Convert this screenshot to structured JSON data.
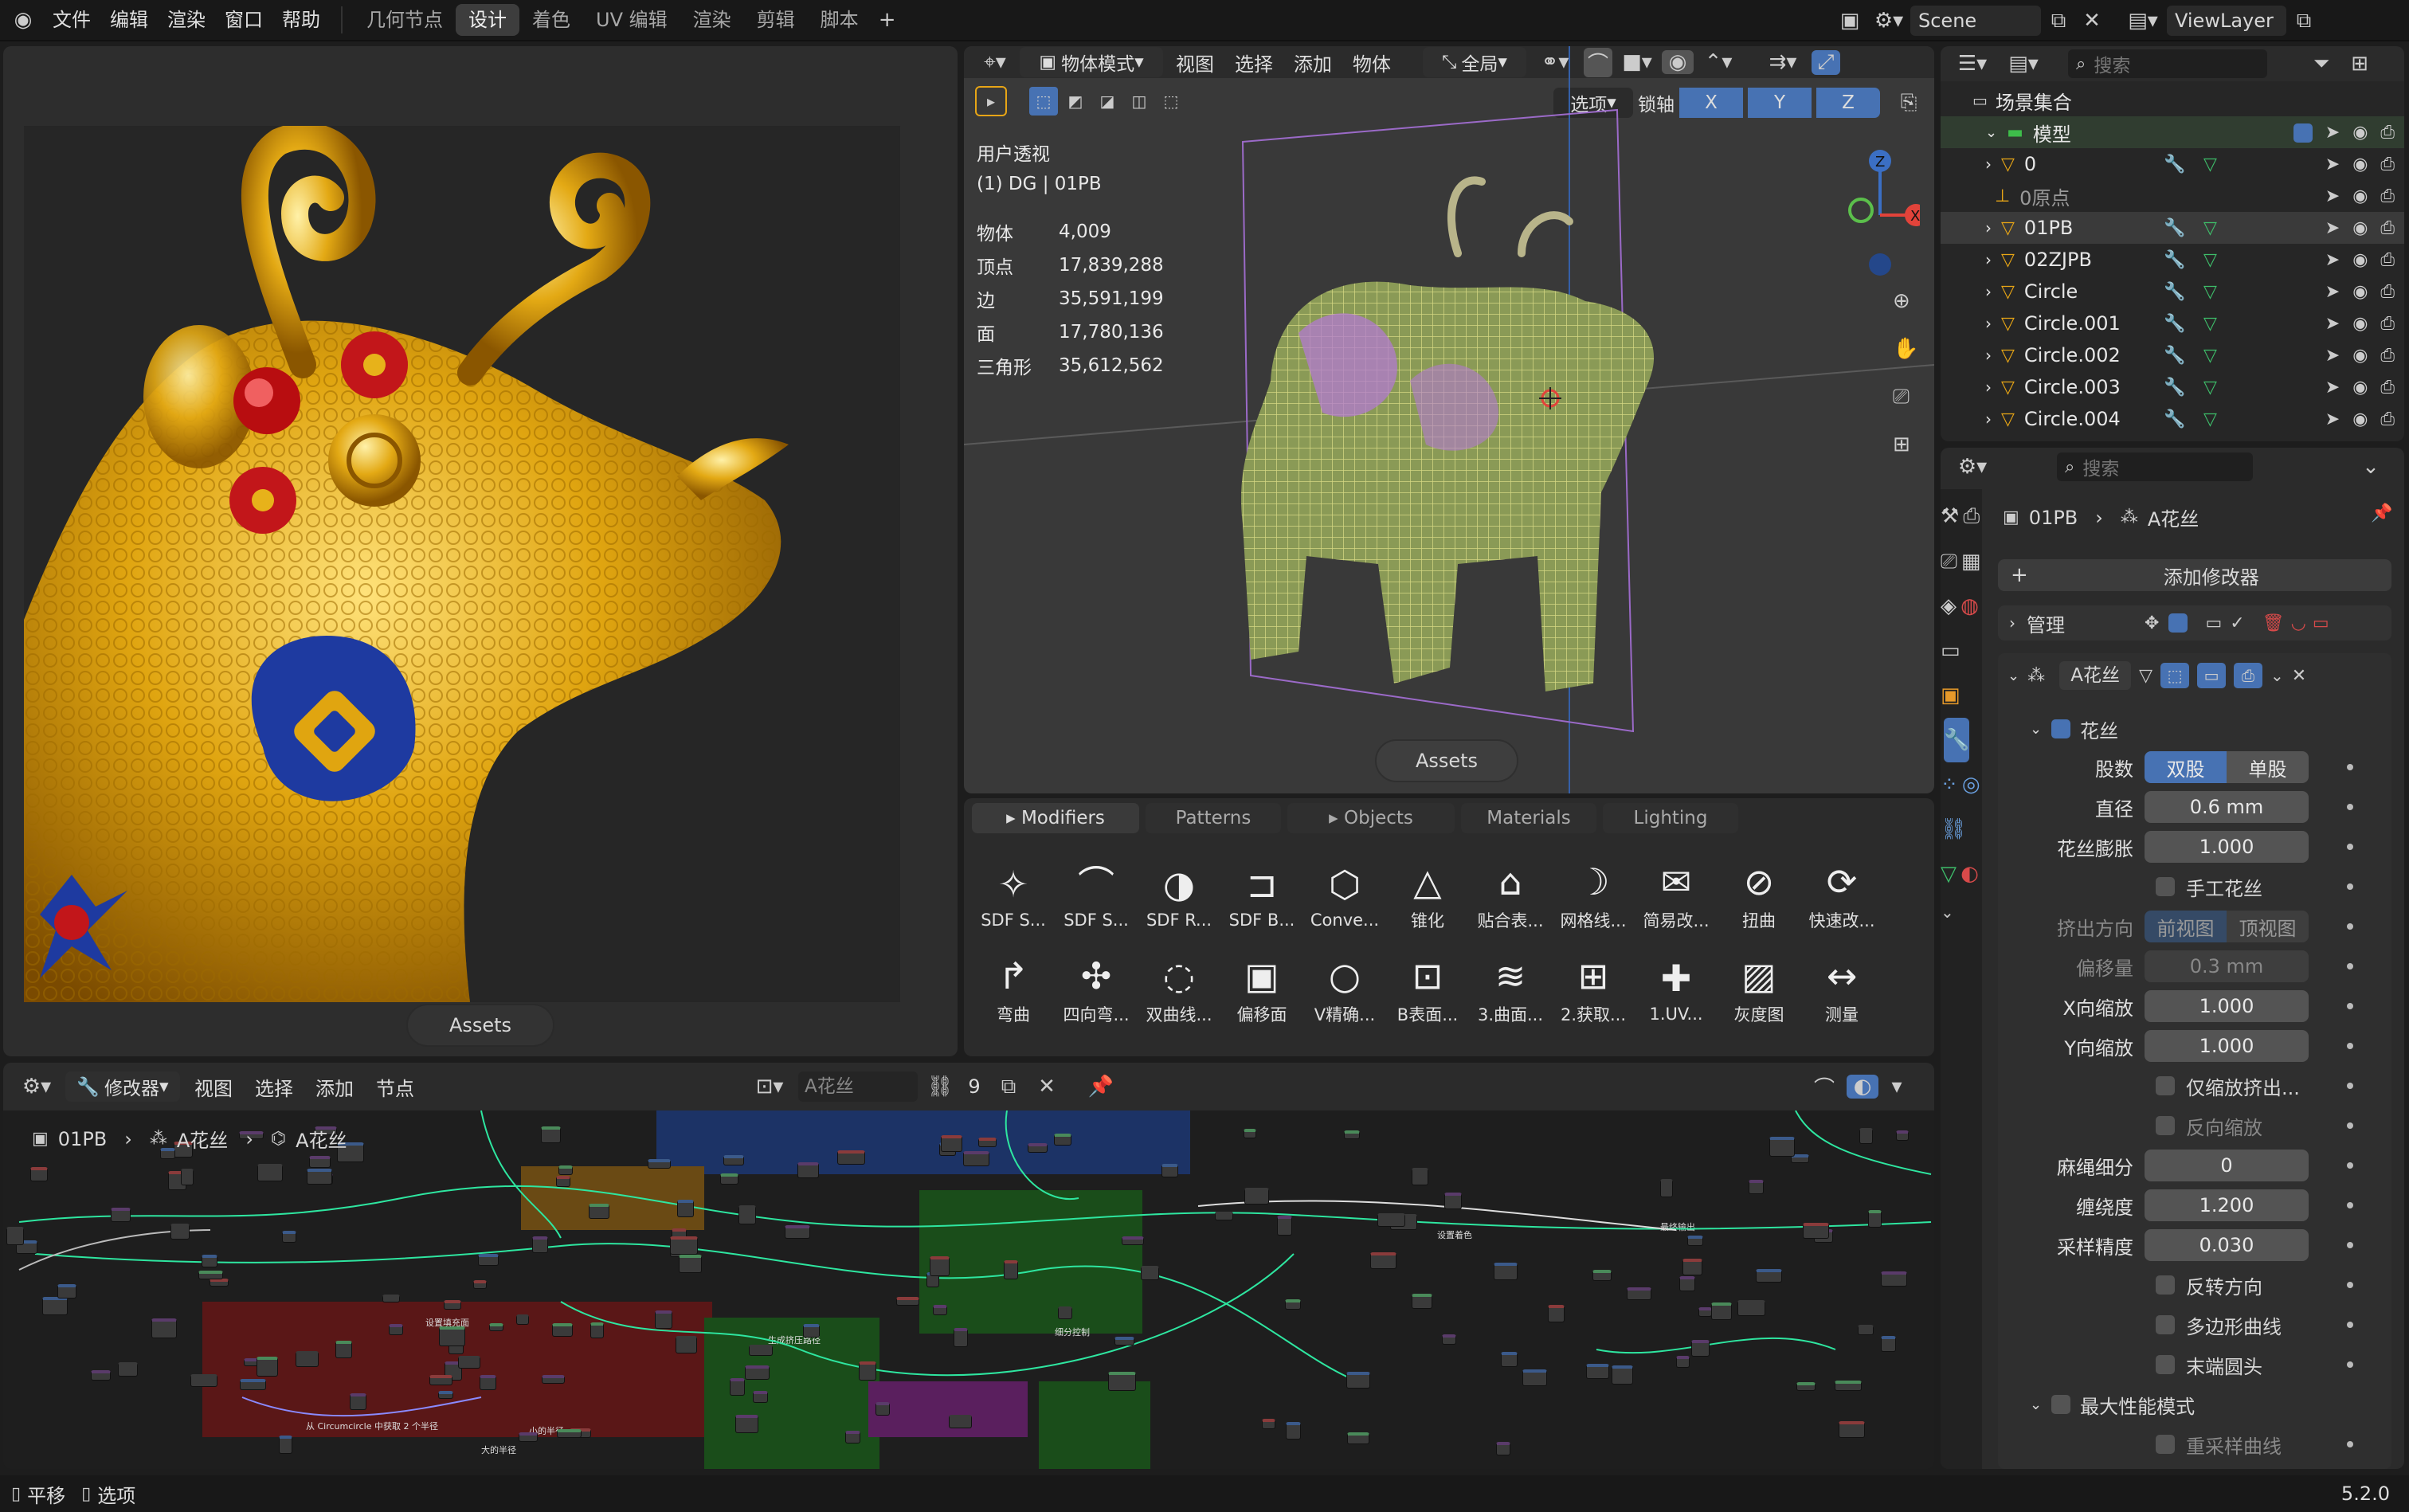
{
  "topbar": {
    "menus": [
      "文件",
      "编辑",
      "渲染",
      "窗口",
      "帮助"
    ],
    "workspaces": [
      "几何节点",
      "设计",
      "着色",
      "UV 编辑",
      "渲染",
      "剪辑",
      "脚本"
    ],
    "active_workspace": "设计",
    "scene": "Scene",
    "view_layer": "ViewLayer"
  },
  "viewport": {
    "mode": "物体模式",
    "menus": [
      "视图",
      "选择",
      "添加",
      "物体"
    ],
    "transform": "全局",
    "options": "选项",
    "lock_axis": "锁轴",
    "axes": [
      "X",
      "Y",
      "Z"
    ],
    "view_name": "用户透视",
    "collection": "(1) DG | 01PB",
    "stats": [
      {
        "k": "物体",
        "v": "4,009"
      },
      {
        "k": "顶点",
        "v": "17,839,288"
      },
      {
        "k": "边",
        "v": "35,591,199"
      },
      {
        "k": "面",
        "v": "17,780,136"
      },
      {
        "k": "三角形",
        "v": "35,612,562"
      }
    ],
    "assets_btn": "Assets"
  },
  "render_view": {
    "assets_btn": "Assets"
  },
  "assets": {
    "tabs": [
      "Modifiers",
      "Patterns",
      "Objects",
      "Materials",
      "Lighting"
    ],
    "row1": [
      {
        "icon": "sdf-star-icon",
        "label": "SDF S..."
      },
      {
        "icon": "sdf-curve-icon",
        "label": "SDF S..."
      },
      {
        "icon": "sdf-revolve-icon",
        "label": "SDF R..."
      },
      {
        "icon": "sdf-box-icon",
        "label": "SDF B..."
      },
      {
        "icon": "convex-icon",
        "label": "Conve..."
      },
      {
        "icon": "cone-icon",
        "label": "锥化"
      },
      {
        "icon": "surface-icon",
        "label": "贴合表..."
      },
      {
        "icon": "grid-line-icon",
        "label": "网格线..."
      },
      {
        "icon": "easy-icon",
        "label": "简易改..."
      },
      {
        "icon": "twist-icon",
        "label": "扭曲"
      },
      {
        "icon": "quick-icon",
        "label": "快速改..."
      }
    ],
    "row2": [
      {
        "icon": "bend-icon",
        "label": "弯曲"
      },
      {
        "icon": "quad-bend-icon",
        "label": "四向弯..."
      },
      {
        "icon": "double-curve-icon",
        "label": "双曲线..."
      },
      {
        "icon": "offset-icon",
        "label": "偏移面"
      },
      {
        "icon": "v-icon",
        "label": "V精确..."
      },
      {
        "icon": "b-surface-icon",
        "label": "B表面..."
      },
      {
        "icon": "curved-surface-icon",
        "label": "3.曲面..."
      },
      {
        "icon": "fetch-icon",
        "label": "2.获取..."
      },
      {
        "icon": "uv-icon",
        "label": "1.UV..."
      },
      {
        "icon": "gray-image-icon",
        "label": "灰度图"
      },
      {
        "icon": "measure-icon",
        "label": "测量"
      }
    ]
  },
  "node_editor": {
    "editor": "修改器",
    "menus": [
      "视图",
      "选择",
      "添加",
      "节点"
    ],
    "tree_name": "A花丝",
    "users": "9",
    "breadcrumb": [
      "01PB",
      "A花丝",
      "A花丝"
    ],
    "frame_labels": [
      "设置填充面",
      "生成挤压路径",
      "细分控制",
      "设置着色",
      "最终输出",
      "从 Circumcircle 中获取 2 个半径",
      "大的半径",
      "小的半径"
    ]
  },
  "outliner": {
    "search_placeholder": "搜索",
    "root": "场景集合",
    "collection": "模型",
    "items": [
      "0",
      "0原点",
      "01PB",
      "02ZJPB",
      "Circle",
      "Circle.001",
      "Circle.002",
      "Circle.003",
      "Circle.004"
    ]
  },
  "properties": {
    "search_placeholder": "搜索",
    "object": "01PB",
    "modifier_path": "A花丝",
    "add_modifier": "添加修改器",
    "manage": "管理",
    "modifier_name": "A花丝",
    "section": "花丝",
    "strands_label": "股数",
    "strand_options": [
      "双股",
      "单股"
    ],
    "fields": [
      {
        "label": "直径",
        "value": "0.6 mm"
      },
      {
        "label": "花丝膨胀",
        "value": "1.000"
      }
    ],
    "handmade": "手工花丝",
    "extrude_dir": "挤出方向",
    "extrude_options": [
      "前视图",
      "顶视图"
    ],
    "offset": {
      "label": "偏移量",
      "value": "0.3 mm"
    },
    "x_scale": {
      "label": "X向缩放",
      "value": "1.000"
    },
    "y_scale": {
      "label": "Y向缩放",
      "value": "1.000"
    },
    "scale_extrude_only": "仅缩放挤出...",
    "reverse_scale": "反向缩放",
    "rope_subdiv": {
      "label": "麻绳细分",
      "value": "0"
    },
    "twist": {
      "label": "缠绕度",
      "value": "1.200"
    },
    "sample": {
      "label": "采样精度",
      "value": "0.030"
    },
    "flip_dir": "反转方向",
    "poly_curve": "多边形曲线",
    "round_cap": "末端圆头",
    "perf_mode": "最大性能模式",
    "resample": "重采样曲线"
  },
  "statusbar": {
    "pan": "平移",
    "options": "选项",
    "version": "5.2.0"
  },
  "colors": {
    "accent": "#4772b3",
    "frame_red": "#5a1717",
    "frame_green": "#1a4d1a",
    "frame_blue": "#1c3366",
    "wire": "#2ee6a0"
  }
}
